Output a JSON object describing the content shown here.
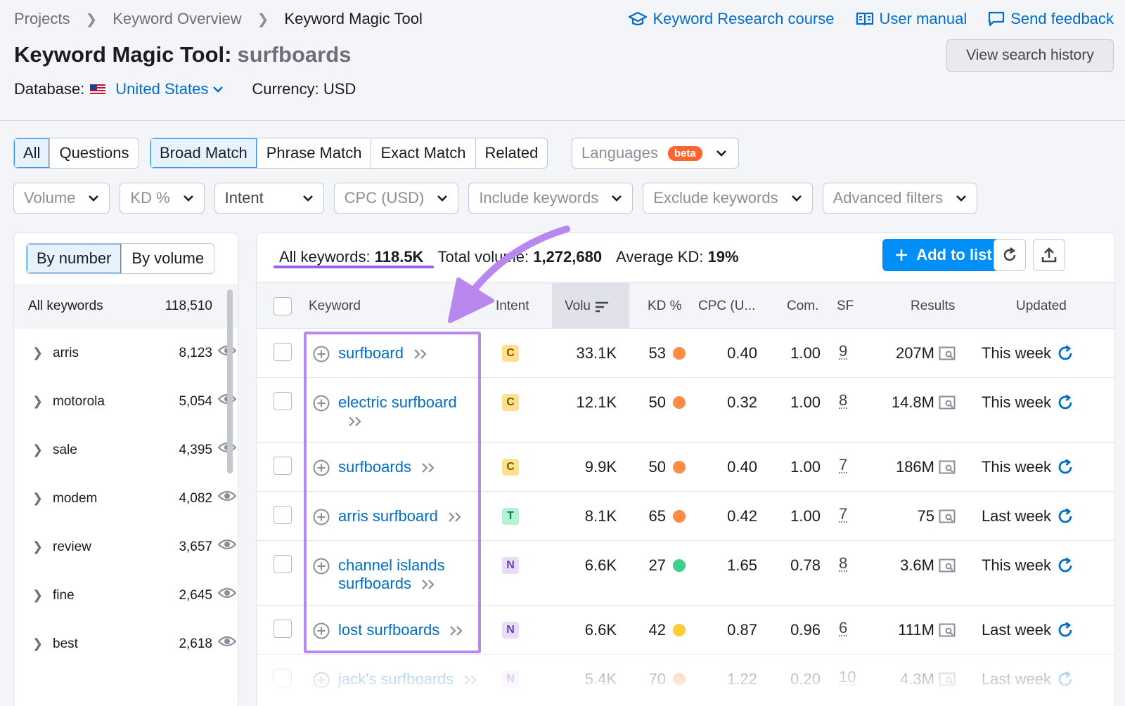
{
  "breadcrumbs": [
    "Projects",
    "Keyword Overview",
    "Keyword Magic Tool"
  ],
  "top_links": {
    "course": "Keyword Research course",
    "manual": "User manual",
    "feedback": "Send feedback"
  },
  "title": {
    "label": "Keyword Magic Tool:",
    "query": "surfboards"
  },
  "history_button": "View search history",
  "database": {
    "label": "Database:",
    "country": "United States",
    "currency": "Currency: USD"
  },
  "tabs_left": [
    "All",
    "Questions"
  ],
  "tabs_match": [
    "Broad Match",
    "Phrase Match",
    "Exact Match",
    "Related"
  ],
  "languages": {
    "label": "Languages",
    "badge": "beta"
  },
  "filters": [
    "Volume",
    "KD %",
    "Intent",
    "CPC (USD)",
    "Include keywords",
    "Exclude keywords",
    "Advanced filters"
  ],
  "group_tabs": [
    "By number",
    "By volume"
  ],
  "all_keywords_row": {
    "label": "All keywords",
    "count": "118,510"
  },
  "groups": [
    {
      "name": "arris",
      "count": "8,123"
    },
    {
      "name": "motorola",
      "count": "5,054"
    },
    {
      "name": "sale",
      "count": "4,395"
    },
    {
      "name": "modem",
      "count": "4,082"
    },
    {
      "name": "review",
      "count": "3,657"
    },
    {
      "name": "fine",
      "count": "2,645"
    },
    {
      "name": "best",
      "count": "2,618"
    }
  ],
  "stats": {
    "all_label": "All keywords:",
    "all_value": "118.5K",
    "volume_label": "Total volume:",
    "volume_value": "1,272,680",
    "kd_label": "Average KD:",
    "kd_value": "19%"
  },
  "add_button": "Add to list",
  "columns": [
    "Keyword",
    "Intent",
    "Volu",
    "KD %",
    "CPC (U...",
    "Com.",
    "SF",
    "Results",
    "Updated"
  ],
  "colors": {
    "accent": "#006dca",
    "primary_button": "#008ff8",
    "highlight": "#b888ef",
    "kd_orange": "#ff8c43",
    "kd_green": "#3ecf8e",
    "kd_yellow": "#ffcc33"
  },
  "rows": [
    {
      "keyword": "surfboard",
      "intent": "C",
      "volume": "33.1K",
      "kd": "53",
      "kd_color": "#ff8c43",
      "cpc": "0.40",
      "com": "1.00",
      "sf": "9",
      "results": "207M",
      "updated": "This week"
    },
    {
      "keyword": "electric surfboard",
      "intent": "C",
      "volume": "12.1K",
      "kd": "50",
      "kd_color": "#ff8c43",
      "cpc": "0.32",
      "com": "1.00",
      "sf": "8",
      "results": "14.8M",
      "updated": "This week"
    },
    {
      "keyword": "surfboards",
      "intent": "C",
      "volume": "9.9K",
      "kd": "50",
      "kd_color": "#ff8c43",
      "cpc": "0.40",
      "com": "1.00",
      "sf": "7",
      "results": "186M",
      "updated": "This week"
    },
    {
      "keyword": "arris surfboard",
      "intent": "T",
      "volume": "8.1K",
      "kd": "65",
      "kd_color": "#ff8c43",
      "cpc": "0.42",
      "com": "1.00",
      "sf": "7",
      "results": "75",
      "updated": "Last week"
    },
    {
      "keyword": "channel islands surfboards",
      "intent": "N",
      "volume": "6.6K",
      "kd": "27",
      "kd_color": "#3ecf8e",
      "cpc": "1.65",
      "com": "0.78",
      "sf": "8",
      "results": "3.6M",
      "updated": "This week"
    },
    {
      "keyword": "lost surfboards",
      "intent": "N",
      "volume": "6.6K",
      "kd": "42",
      "kd_color": "#ffcc33",
      "cpc": "0.87",
      "com": "0.96",
      "sf": "6",
      "results": "111M",
      "updated": "Last week"
    },
    {
      "keyword": "jack's surfboards",
      "intent": "N",
      "volume": "5.4K",
      "kd": "70",
      "kd_color": "#ff8c43",
      "cpc": "1.22",
      "com": "0.20",
      "sf": "10",
      "results": "4.3M",
      "updated": "Last week"
    }
  ]
}
